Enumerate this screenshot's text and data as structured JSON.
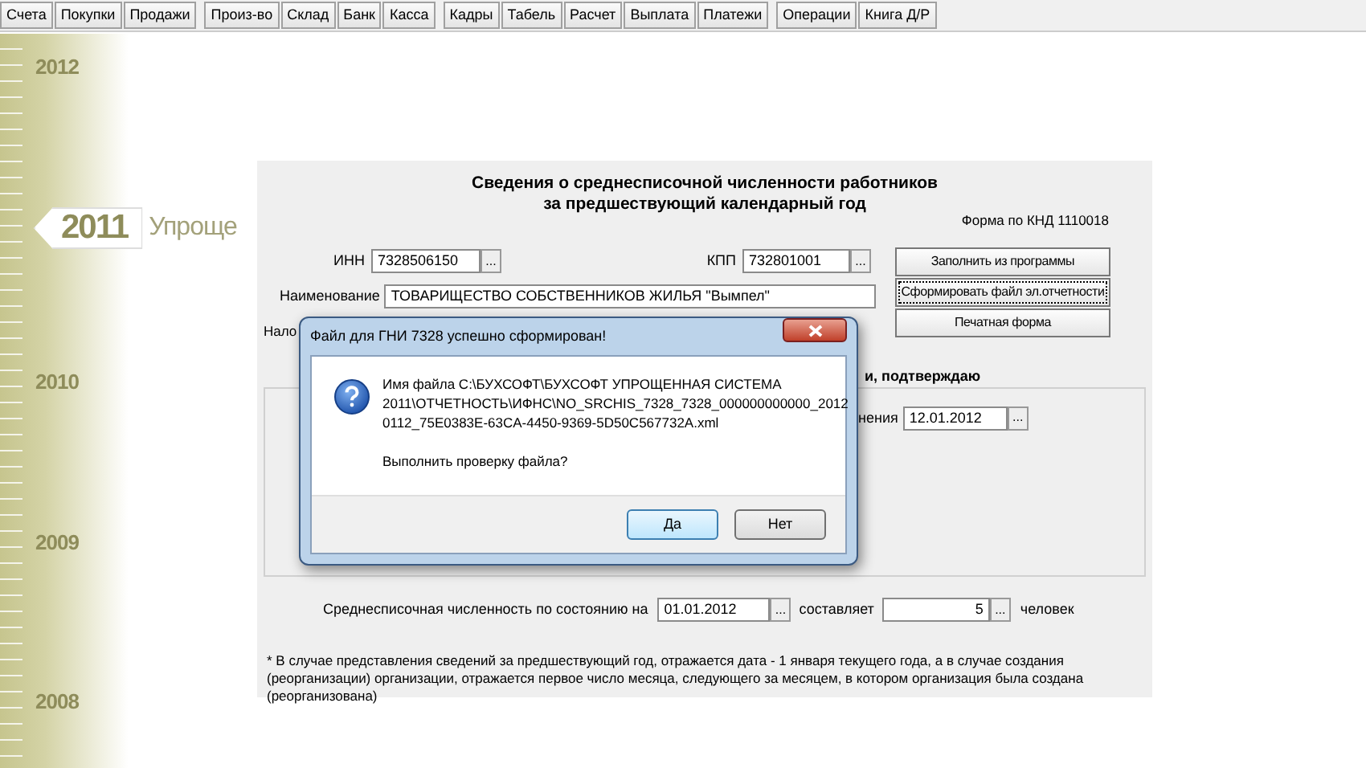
{
  "toolbar": {
    "groups": [
      [
        {
          "label": "Счета"
        },
        {
          "label": "Покупки"
        },
        {
          "label": "Продажи"
        }
      ],
      [
        {
          "label": "Произ-во"
        },
        {
          "label": "Склад"
        },
        {
          "label": "Банк"
        },
        {
          "label": "Касса"
        }
      ],
      [
        {
          "label": "Кадры"
        },
        {
          "label": "Табель"
        },
        {
          "label": "Расчет"
        },
        {
          "label": "Выплата"
        },
        {
          "label": "Платежи"
        }
      ],
      [
        {
          "label": "Операции"
        },
        {
          "label": "Книга Д/Р"
        }
      ]
    ]
  },
  "timeline": {
    "years": [
      {
        "label": "2012",
        "selected": false
      },
      {
        "label": "2011",
        "selected": true,
        "caption": "Упроще"
      },
      {
        "label": "2010",
        "selected": false
      },
      {
        "label": "2009",
        "selected": false
      },
      {
        "label": "2008",
        "selected": false
      }
    ]
  },
  "form": {
    "title_lines": [
      "Сведения о среднесписочной численности работников",
      "за предшествующий календарный год"
    ],
    "form_code": "Форма по КНД 1110018",
    "inn": {
      "label": "ИНН",
      "value": "7328506150",
      "picker": "..."
    },
    "kpp": {
      "label": "КПП",
      "value": "732801001",
      "picker": "..."
    },
    "name": {
      "label": "Наименование",
      "value": "ТОВАРИЩЕСТВО СОБСТВЕННИКОВ ЖИЛЬЯ \"Вымпел\""
    },
    "tax_label": "Нало",
    "section_heading": "и, подтверждаю",
    "date": {
      "label": "нения",
      "value": "12.01.2012",
      "picker": "..."
    },
    "headcount": {
      "label": "Среднесписочная численность по состоянию на",
      "date": "01.01.2012",
      "date_picker": "...",
      "verb": "составляет",
      "value": "5",
      "value_picker": "...",
      "unit": "человек"
    },
    "note": "* В случае представления сведений за предшествующий год, отражается дата - 1 января текущего года, а в случае создания (реорганизации) организации, отражается первое число месяца, следующего за месяцем, в котором организация была создана (реорганизована)",
    "buttons": [
      {
        "label": "Заполнить из программы",
        "focused": false
      },
      {
        "label": "Сформировать файл эл.отчетности",
        "focused": true
      },
      {
        "label": "Печатная форма",
        "focused": false
      }
    ]
  },
  "dialog": {
    "title": "Файл для ГНИ 7328 успешно сформирован!",
    "message_lines": [
      "Имя файла C:\\БУХСОФТ\\БУХСОФТ УПРОЩЕННАЯ СИСТЕМА",
      "2011\\ОТЧЕТНОСТЬ\\ИФНС\\NO_SRCHIS_7328_7328_000000000000_2012",
      "0112_75E0383E-63CA-4450-9369-5D50C567732A.xml"
    ],
    "question": "Выполнить проверку файла?",
    "buttons": [
      {
        "label": "Да",
        "selected": true
      },
      {
        "label": "Нет",
        "selected": false
      }
    ]
  }
}
